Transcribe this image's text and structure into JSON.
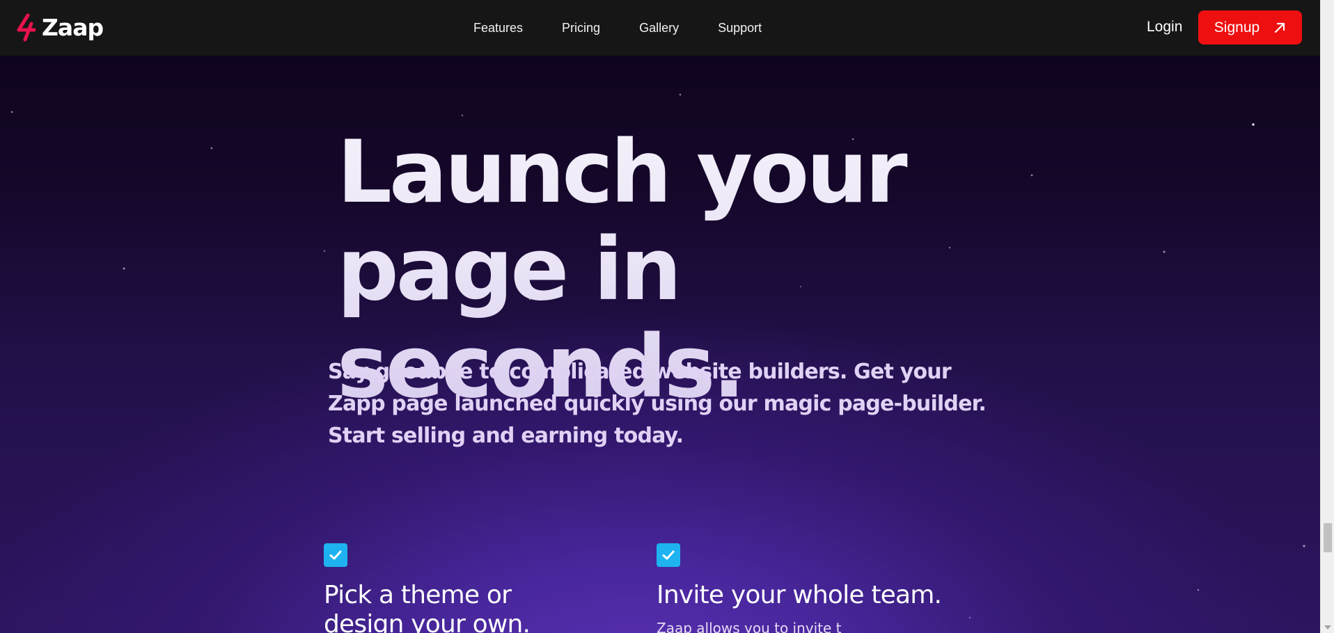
{
  "nav": {
    "brand": "Zaap",
    "links": [
      "Features",
      "Pricing",
      "Gallery",
      "Support"
    ],
    "login": "Login",
    "signup": "Signup"
  },
  "hero": {
    "title_lines": [
      "Launch your",
      "page in seconds."
    ],
    "subtitle_lines": [
      "Say goodbye to complicated website builders. Get your",
      "Zapp page launched quickly using our magic page-builder.",
      "Start selling and earning today."
    ]
  },
  "features": [
    {
      "title_lines": [
        "Pick a theme or",
        "design your own."
      ],
      "description": ""
    },
    {
      "title_lines": [
        "Invite your whole team."
      ],
      "description": "Zaap allows you to invite t"
    }
  ],
  "colors": {
    "nav_bg": "#161616",
    "signup_bg": "#ee0f10",
    "logo_mark": "#e8124d",
    "check_bg": "#1eb3f0",
    "hero_top": "#0f0420",
    "hero_glow": "#5a30b4"
  },
  "icons": {
    "logo": "zaap-logo-mark",
    "signup": "arrow-up-right-icon",
    "check": "checkmark-icon"
  }
}
